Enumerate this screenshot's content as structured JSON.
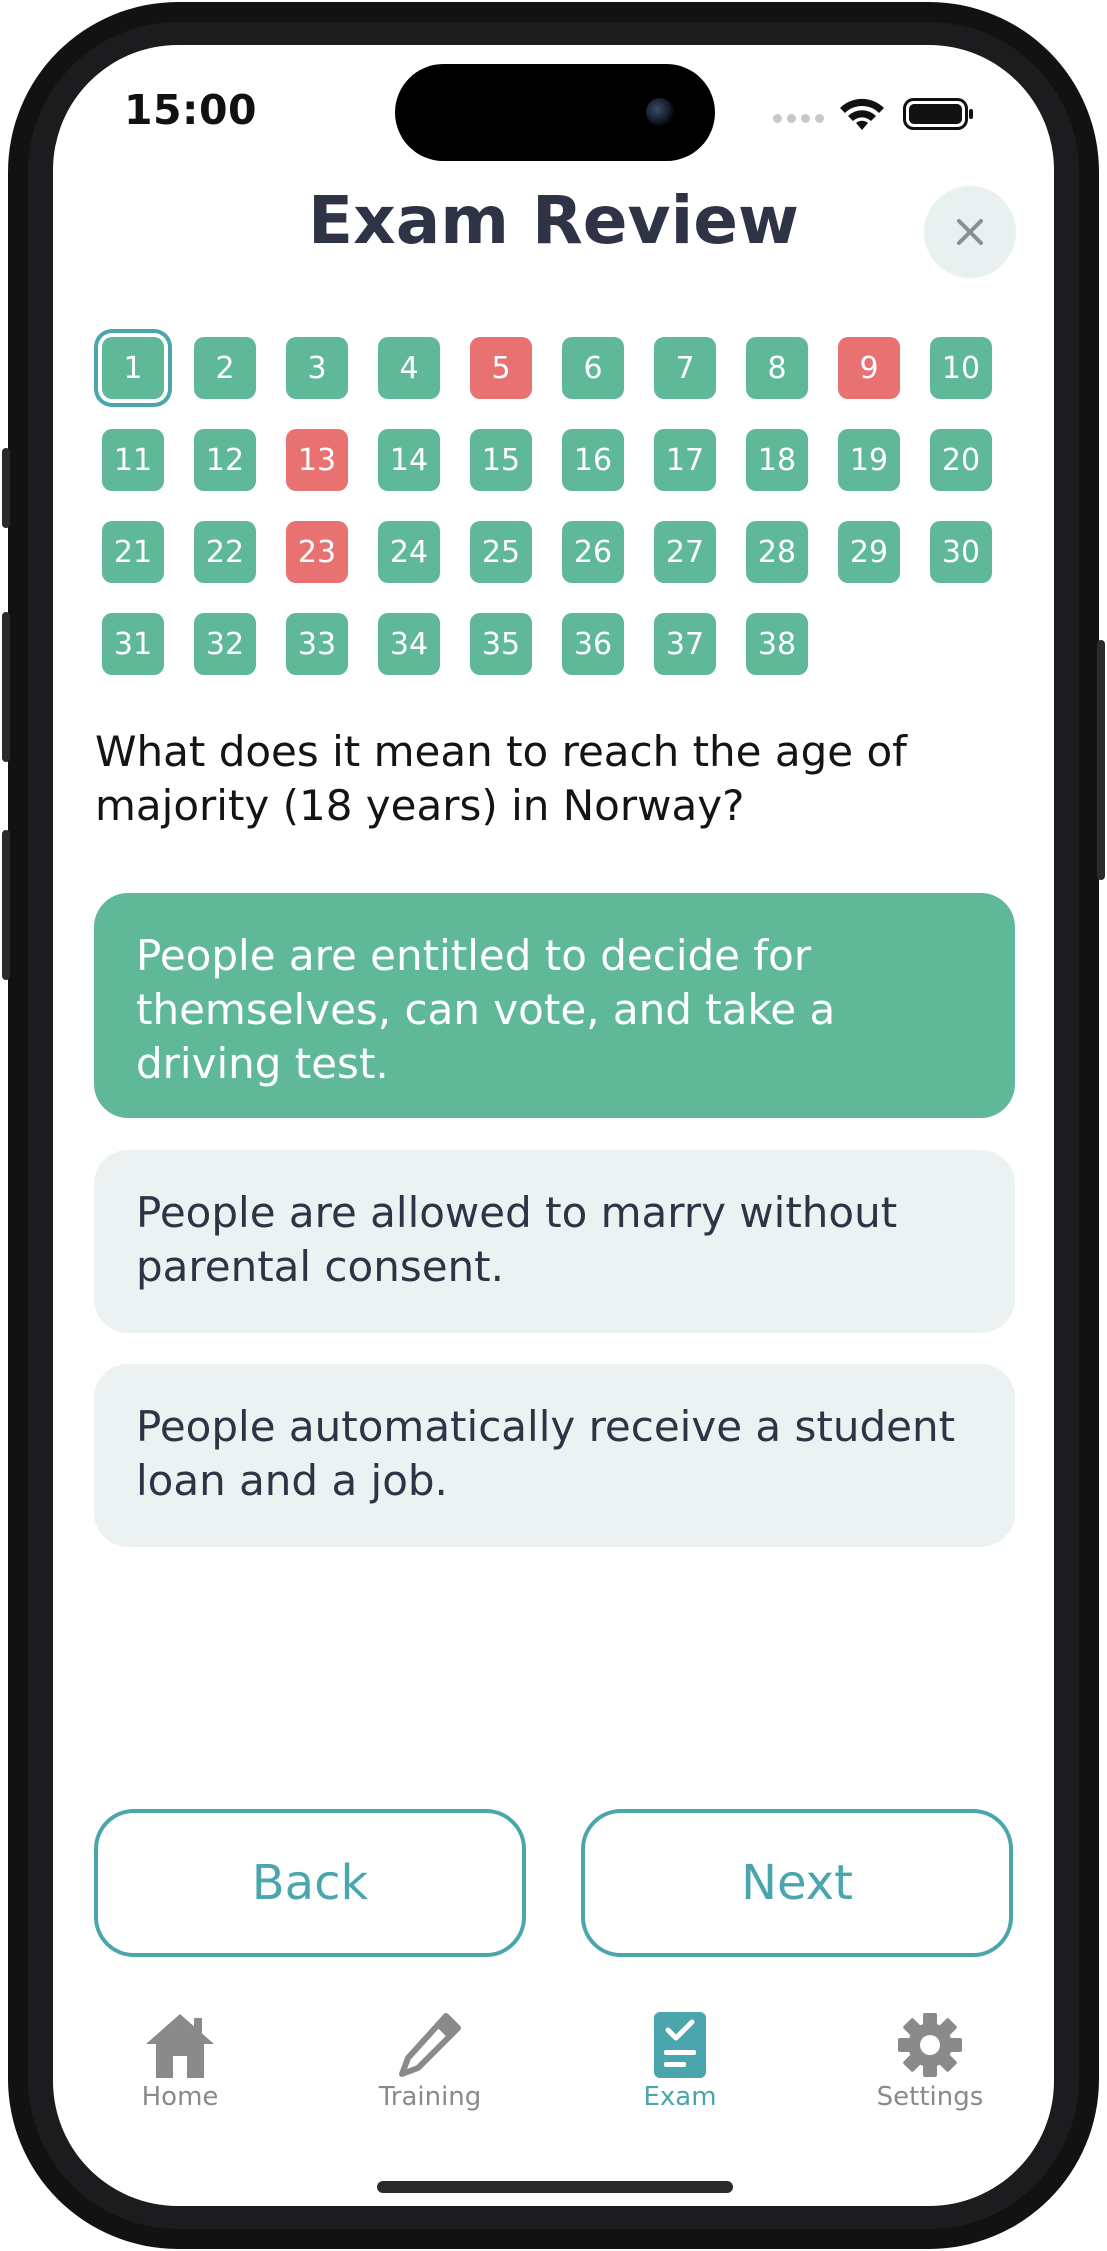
{
  "status": {
    "time": "15:00"
  },
  "header": {
    "title": "Exam Review",
    "close_icon": "close-icon"
  },
  "questions": {
    "current": 1,
    "items": [
      {
        "n": "1",
        "state": "correct"
      },
      {
        "n": "2",
        "state": "correct"
      },
      {
        "n": "3",
        "state": "correct"
      },
      {
        "n": "4",
        "state": "correct"
      },
      {
        "n": "5",
        "state": "wrong"
      },
      {
        "n": "6",
        "state": "correct"
      },
      {
        "n": "7",
        "state": "correct"
      },
      {
        "n": "8",
        "state": "correct"
      },
      {
        "n": "9",
        "state": "wrong"
      },
      {
        "n": "10",
        "state": "correct"
      },
      {
        "n": "11",
        "state": "correct"
      },
      {
        "n": "12",
        "state": "correct"
      },
      {
        "n": "13",
        "state": "wrong"
      },
      {
        "n": "14",
        "state": "correct"
      },
      {
        "n": "15",
        "state": "correct"
      },
      {
        "n": "16",
        "state": "correct"
      },
      {
        "n": "17",
        "state": "correct"
      },
      {
        "n": "18",
        "state": "correct"
      },
      {
        "n": "19",
        "state": "correct"
      },
      {
        "n": "20",
        "state": "correct"
      },
      {
        "n": "21",
        "state": "correct"
      },
      {
        "n": "22",
        "state": "correct"
      },
      {
        "n": "23",
        "state": "wrong"
      },
      {
        "n": "24",
        "state": "correct"
      },
      {
        "n": "25",
        "state": "correct"
      },
      {
        "n": "26",
        "state": "correct"
      },
      {
        "n": "27",
        "state": "correct"
      },
      {
        "n": "28",
        "state": "correct"
      },
      {
        "n": "29",
        "state": "correct"
      },
      {
        "n": "30",
        "state": "correct"
      },
      {
        "n": "31",
        "state": "correct"
      },
      {
        "n": "32",
        "state": "correct"
      },
      {
        "n": "33",
        "state": "correct"
      },
      {
        "n": "34",
        "state": "correct"
      },
      {
        "n": "35",
        "state": "correct"
      },
      {
        "n": "36",
        "state": "correct"
      },
      {
        "n": "37",
        "state": "correct"
      },
      {
        "n": "38",
        "state": "correct"
      }
    ]
  },
  "question": {
    "text": "What does it mean to reach the age of majority (18 years) in Norway?"
  },
  "answers": [
    {
      "text": "People are entitled to decide for themselves, can vote, and take a driving test.",
      "state": "correct"
    },
    {
      "text": "People are allowed to marry without parental consent.",
      "state": "neutral"
    },
    {
      "text": "People automatically receive a student loan and a job.",
      "state": "neutral"
    }
  ],
  "nav": {
    "back_label": "Back",
    "next_label": "Next"
  },
  "tabbar": {
    "items": [
      {
        "label": "Home",
        "icon": "home-icon",
        "active": false
      },
      {
        "label": "Training",
        "icon": "pencil-icon",
        "active": false
      },
      {
        "label": "Exam",
        "icon": "exam-clipboard-icon",
        "active": true
      },
      {
        "label": "Settings",
        "icon": "gear-icon",
        "active": false
      }
    ]
  },
  "colors": {
    "correct": "#5fb998",
    "wrong": "#e87272",
    "accent": "#4aa6ac",
    "title": "#2e3446",
    "neutral_answer_bg": "#ebf2f1",
    "tab_inactive": "#8a8a8a"
  }
}
